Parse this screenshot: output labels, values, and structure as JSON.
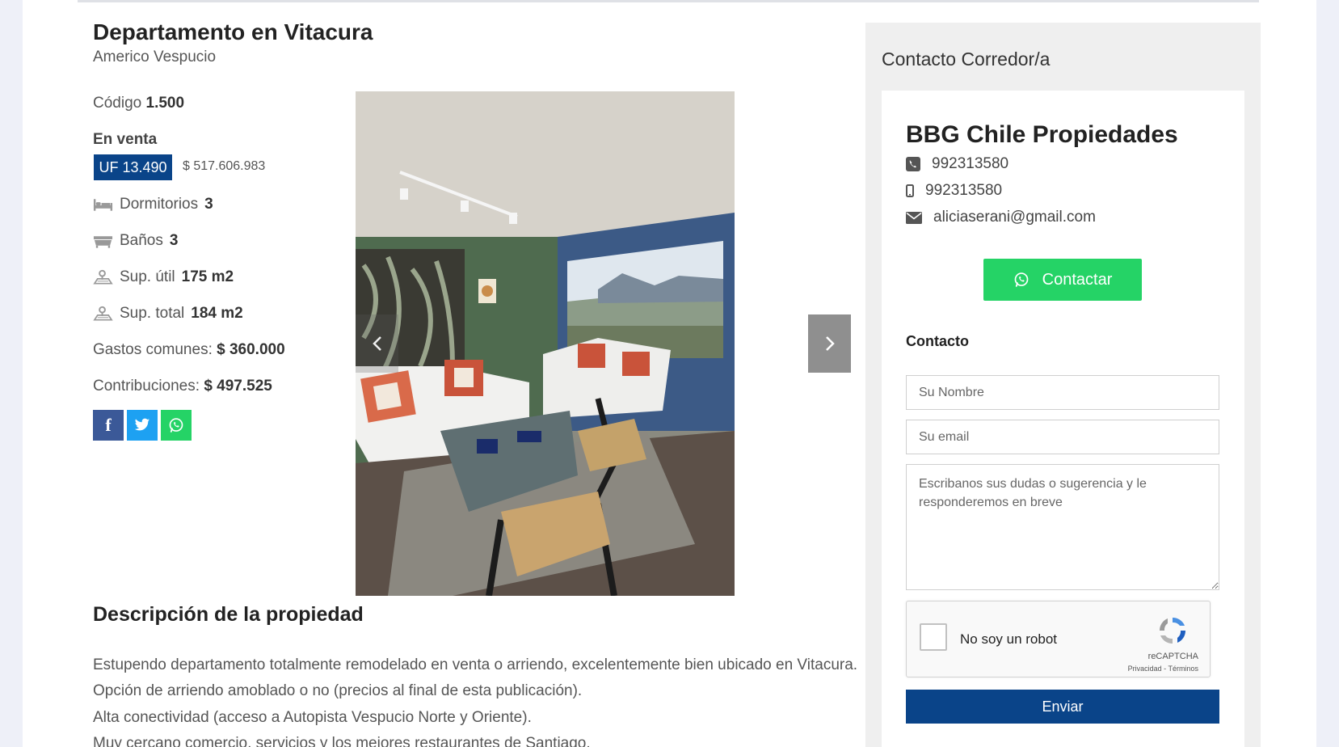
{
  "property": {
    "title": "Departamento en Vitacura",
    "address": "Americo Vespucio",
    "code_label": "Código",
    "code_value": "1.500",
    "status": "En venta",
    "price_uf": "UF 13.490",
    "price_clp": "$ 517.606.983",
    "features": [
      {
        "label": "Dormitorios",
        "value": "3",
        "icon": "bed-icon"
      },
      {
        "label": "Baños",
        "value": "3",
        "icon": "bathtub-icon"
      },
      {
        "label": "Sup. útil",
        "value": "175 m2",
        "icon": "area-icon"
      },
      {
        "label": "Sup. total",
        "value": "184 m2",
        "icon": "area-icon"
      }
    ],
    "common_expenses_label": "Gastos comunes:",
    "common_expenses_value": "$ 360.000",
    "contributions_label": "Contribuciones:",
    "contributions_value": "$ 497.525"
  },
  "share": {
    "facebook_glyph": "f",
    "icons": [
      "facebook-icon",
      "twitter-icon",
      "whatsapp-icon"
    ]
  },
  "description": {
    "heading": "Descripción de la propiedad",
    "lines": [
      "Estupendo departamento totalmente remodelado en venta o arriendo, excelentemente bien ubicado en Vitacura.",
      "Opción de arriendo amoblado o no (precios al final de esta publicación).",
      "Alta conectividad (acceso a Autopista Vespucio Norte y Oriente).",
      "Muy cercano comercio, servicios y los mejores restaurantes de Santiago."
    ]
  },
  "contact": {
    "heading": "Contacto Corredor/a",
    "company": "BBG Chile Propiedades",
    "phone": "992313580",
    "mobile": "992313580",
    "email": "aliciaserani@gmail.com",
    "whatsapp_button": "Contactar",
    "form_title": "Contacto",
    "name_placeholder": "Su Nombre",
    "email_placeholder": "Su email",
    "message_placeholder": "Escribanos sus dudas o sugerencia y le responderemos en breve",
    "captcha_label": "No soy un robot",
    "captcha_brand": "reCAPTCHA",
    "captcha_links": "Privacidad - Términos",
    "submit_label": "Enviar"
  },
  "colors": {
    "primary": "#0a4489",
    "whatsapp": "#25d366",
    "facebook": "#3b5998",
    "twitter": "#1da1f2"
  }
}
